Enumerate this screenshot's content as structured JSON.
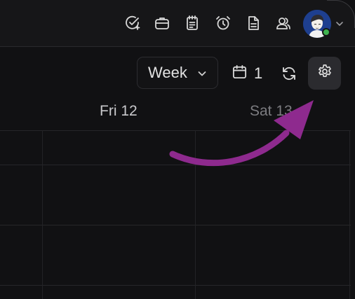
{
  "toolbar": {
    "icons": [
      "tasks-icon",
      "briefcase-icon",
      "notepad-icon",
      "alarm-icon",
      "document-icon",
      "users-icon"
    ]
  },
  "user": {
    "avatar": "user-avatar",
    "status_color": "#3fb34f"
  },
  "controls": {
    "view_label": "Week",
    "calendar_count": "1"
  },
  "days": [
    {
      "label": "Fri 12"
    },
    {
      "label": "Sat 13"
    }
  ],
  "colors": {
    "background": "#111113",
    "settings_button": "#2b2b2f",
    "annotation_arrow": "#8e2a8e"
  }
}
